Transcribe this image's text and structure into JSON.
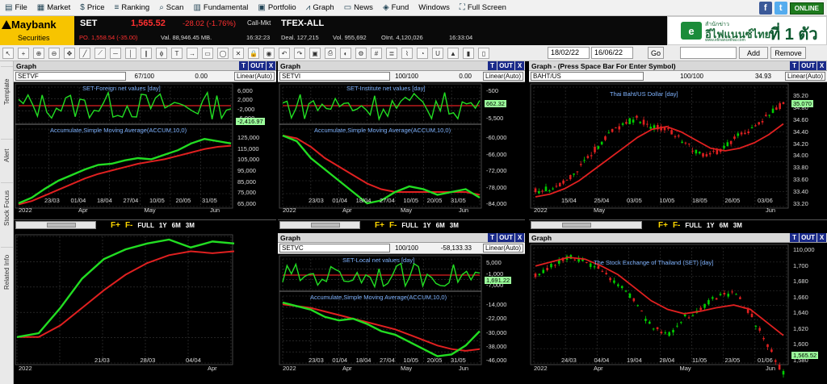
{
  "menu": [
    {
      "icon": "file-icon",
      "label": "File"
    },
    {
      "icon": "market-icon",
      "label": "Market"
    },
    {
      "icon": "price-icon",
      "label": "Price"
    },
    {
      "icon": "ranking-icon",
      "label": "Ranking"
    },
    {
      "icon": "scan-icon",
      "label": "Scan"
    },
    {
      "icon": "fundamental-icon",
      "label": "Fundamental"
    },
    {
      "icon": "portfolio-icon",
      "label": "Portfolio"
    },
    {
      "icon": "graph-icon",
      "label": "Graph"
    },
    {
      "icon": "news-icon",
      "label": "News"
    },
    {
      "icon": "fund-icon",
      "label": "Fund"
    },
    {
      "icon": "",
      "label": "Windows"
    },
    {
      "icon": "full-screen-icon",
      "label": "Full Screen"
    }
  ],
  "social": {
    "facebook": "f",
    "twitter": "t",
    "online": "ONLINE"
  },
  "ticker": {
    "brand": "Maybank",
    "brand_sub": "Securities",
    "set_label": "SET",
    "set_value": "1,565.52",
    "set_change": "-28.02 (-1.76%)",
    "set_state": "Call-Mkt",
    "po": "PO. 1,558.54 (-35.00)",
    "val": "Val. 88,946.45 MB.",
    "time1": "16:32:23",
    "tfex_label": "TFEX-ALL",
    "deal": "Deal. 127,215",
    "vol": "Vol. 955,692",
    "oint": "OInt. 4,120,026",
    "time2": "16:33:04"
  },
  "ad": {
    "line1": "สำนักข่าว",
    "brand": "อีไฟแนนซ์ไทย",
    "url": "www.efinancethai.com",
    "slogan": "ที่ 1 ตัวจริง"
  },
  "toolbar": {
    "date_from": "18/02/22",
    "date_to": "16/06/22",
    "go": "Go",
    "add": "Add",
    "remove": "Remove"
  },
  "sidebar": [
    "Template",
    "Alert",
    "Stock Focus",
    "Related Info"
  ],
  "colors": {
    "up": "#00d000",
    "down": "#e02020",
    "ma": "#e02020",
    "accum": "#22dd22",
    "grid": "#3a3a3a",
    "axis": "#cfcfcf"
  },
  "controls": {
    "fplus": "F+",
    "fminus": "F-",
    "full": "FULL",
    "y1": "1Y",
    "m6": "6M",
    "m3": "3M"
  },
  "panels": [
    {
      "title": "Graph",
      "symbol": "SETVF",
      "counter": "67/100",
      "value": "0.00",
      "scale": "Linear(Auto)",
      "sub1": "SET-Foreign net values [day]",
      "sub2": "Accumulate,Simple Moving Average(ACCUM,10,0)",
      "badge": "-2,416.97",
      "yticks1": [
        "6,000",
        "2,000",
        "-2,000",
        "-6,000"
      ],
      "yticks2": [
        "125,000",
        "115,000",
        "105,000",
        "95,000",
        "85,000",
        "75,000",
        "65,000"
      ],
      "xticks": [
        "23/03",
        "01/04",
        "18/04",
        "27/04",
        "10/05",
        "20/05",
        "31/05"
      ],
      "year": "2022",
      "months": [
        "Apr",
        "May",
        "Jun"
      ]
    },
    {
      "title": "Graph",
      "symbol": "SETVI",
      "counter": "100/100",
      "value": "0.00",
      "scale": "Linear(Auto)",
      "sub1": "SET-Institute net values [day]",
      "sub2": "Accumulate,Simple Moving Average(ACCUM,10,0)",
      "badge": "662.32",
      "yticks1": [
        "-500",
        "-5,500"
      ],
      "yticks2": [
        "-60,000",
        "-66,000",
        "-72,000",
        "-78,000",
        "-84,000"
      ],
      "xticks": [
        "23/03",
        "01/04",
        "18/04",
        "27/04",
        "10/05",
        "20/05",
        "31/05"
      ],
      "year": "2022",
      "months": [
        "Apr",
        "May",
        "Jun"
      ]
    },
    {
      "title": "Graph  -  (Press Space Bar For Enter Symbol)",
      "symbol": "BAHT/US",
      "counter": "100/100",
      "value": "34.93",
      "scale": "Linear(Auto)",
      "sub1": "Thai Baht/US Dollar [day]",
      "badge": "35.070",
      "yticks": [
        "35.20",
        "34.80",
        "34.60",
        "34.40",
        "34.20",
        "34.00",
        "33.80",
        "33.60",
        "33.40",
        "33.20"
      ],
      "xticks": [
        "15/04",
        "25/04",
        "03/05",
        "10/05",
        "18/05",
        "26/05",
        "03/06"
      ],
      "year": "2022",
      "months": [
        "May",
        "Jun"
      ]
    },
    {
      "xticks": [
        "21/03",
        "28/03",
        "04/04"
      ],
      "year": "2022",
      "months": [
        "Apr"
      ]
    },
    {
      "title": "Graph",
      "symbol": "SETVC",
      "counter": "100/100",
      "value": "-58,133.33",
      "scale": "Linear(Auto)",
      "sub1": "SET-Local net values [day]",
      "sub2": "Accumulate,Simple Moving Average(ACCUM,10,0)",
      "badge": "1,691.22",
      "yticks1": [
        "5,000",
        "-1,000",
        "-7,000"
      ],
      "yticks2": [
        "-14,000",
        "-22,000",
        "-30,000",
        "-38,000",
        "-46,000"
      ],
      "xticks": [
        "23/03",
        "01/04",
        "18/04",
        "27/04",
        "10/05",
        "20/05",
        "31/05"
      ],
      "year": "2022",
      "months": [
        "Apr",
        "May",
        "Jun"
      ]
    },
    {
      "title": "Graph",
      "sub1": "The Stock Exchange of Thailand (SET) [day]",
      "badge": "1,565.52",
      "yticks": [
        "110,000",
        "1,700",
        "1,680",
        "1,660",
        "1,640",
        "1,620",
        "1,600",
        "1,580"
      ],
      "xticks": [
        "24/03",
        "04/04",
        "19/04",
        "28/04",
        "11/05",
        "23/05",
        "01/06"
      ],
      "year": "2022",
      "months": [
        "Apr",
        "May",
        "Jun"
      ]
    }
  ],
  "chart_data": [
    {
      "type": "line",
      "title": "SET-Foreign net values [day]",
      "series": [
        {
          "name": "ACCUM",
          "values": [
            65000,
            70000,
            78000,
            85000,
            90000,
            95000,
            99000,
            100000,
            103000,
            105000,
            104000,
            108000,
            112000,
            118000,
            122000,
            120000,
            118000
          ]
        },
        {
          "name": "MA",
          "values": [
            64000,
            67000,
            72000,
            77000,
            82000,
            87000,
            91000,
            94000,
            97000,
            100000,
            102000,
            104000,
            107000,
            110000,
            113000,
            115000,
            116000
          ]
        }
      ],
      "ylim": [
        65000,
        125000
      ]
    },
    {
      "type": "line",
      "title": "SET-Institute net values [day]",
      "series": [
        {
          "name": "ACCUM",
          "values": [
            -60000,
            -62000,
            -68000,
            -72000,
            -76000,
            -80000,
            -84000,
            -83000,
            -80000,
            -78000,
            -79000,
            -81000,
            -80000,
            -79000,
            -82000
          ]
        },
        {
          "name": "MA",
          "values": [
            -60000,
            -61000,
            -64000,
            -68000,
            -71000,
            -74000,
            -77000,
            -79000,
            -80000,
            -80000,
            -80000,
            -80000,
            -80000,
            -80000,
            -81000
          ]
        }
      ],
      "ylim": [
        -84000,
        -60000
      ]
    },
    {
      "type": "line",
      "title": "Thai Baht/US Dollar [day]",
      "series": [
        {
          "name": "Close",
          "values": [
            33.45,
            33.5,
            33.6,
            33.9,
            34.2,
            34.5,
            34.7,
            34.8,
            34.65,
            34.6,
            34.4,
            34.2,
            34.1,
            34.3,
            34.5,
            34.6,
            34.9,
            35.07
          ]
        },
        {
          "name": "MA",
          "values": [
            33.35,
            33.4,
            33.5,
            33.65,
            33.85,
            34.05,
            34.25,
            34.45,
            34.6,
            34.65,
            34.55,
            34.4,
            34.25,
            34.2,
            34.25,
            34.35,
            34.5,
            34.7
          ]
        }
      ],
      "ylim": [
        33.2,
        35.2
      ]
    },
    {
      "type": "line",
      "title": "SET [day]",
      "series": [
        {
          "name": "Close",
          "values": [
            1680,
            1690,
            1700,
            1695,
            1685,
            1670,
            1650,
            1620,
            1610,
            1630,
            1640,
            1655,
            1660,
            1635,
            1600,
            1565.52
          ]
        },
        {
          "name": "MA",
          "values": [
            1690,
            1695,
            1700,
            1698,
            1690,
            1680,
            1665,
            1650,
            1640,
            1635,
            1638,
            1642,
            1645,
            1640,
            1625,
            1610
          ]
        }
      ],
      "ylim": [
        1580,
        1700
      ]
    }
  ]
}
